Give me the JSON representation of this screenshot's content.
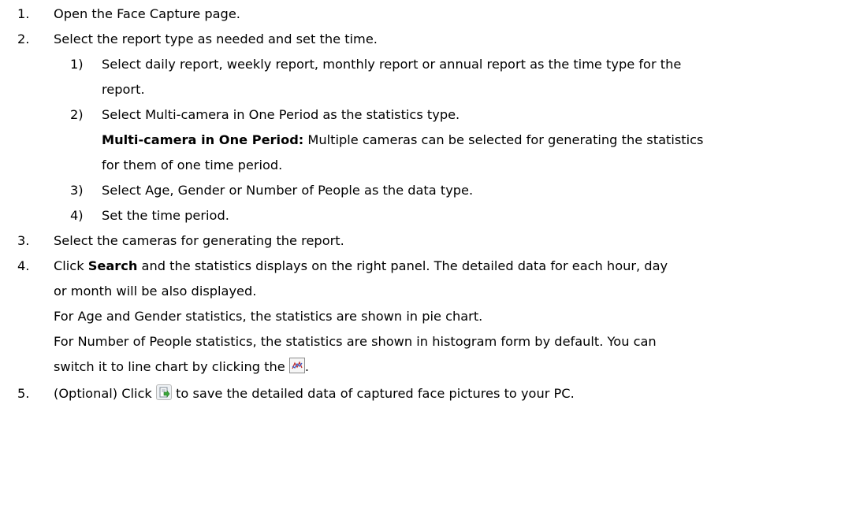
{
  "steps": [
    {
      "num": "1.",
      "text": "Open the Face Capture page."
    },
    {
      "num": "2.",
      "text": "Select the report type as needed and set the time."
    },
    {
      "num": "3.",
      "text": "Select the cameras for generating the report."
    },
    {
      "num": "4.",
      "text_pre": "Click ",
      "bold": "Search",
      "text_post": " and the statistics displays on the right panel. The detailed data for each hour, day"
    },
    {
      "num": "5.",
      "text_pre": "(Optional) Click ",
      "text_post": " to save the detailed data of captured face pictures to your PC."
    }
  ],
  "substeps": [
    {
      "num": "1)",
      "line1": "Select daily report, weekly report, monthly report or annual report as the time type for the",
      "line2": "report."
    },
    {
      "num": "2)",
      "line1": "Select Multi-camera in One Period as the statistics type."
    },
    {
      "num": "3)",
      "text": "Select Age, Gender or Number of People as the data type."
    },
    {
      "num": "4)",
      "text": "Set the time period."
    }
  ],
  "note": {
    "bold": "Multi-camera in One Period:",
    "text": " Multiple cameras can be selected for generating the statistics",
    "line2": "for them of one time period."
  },
  "step4_cont": {
    "line2": "or month will be also displayed.",
    "line3": "For Age and Gender statistics, the statistics are shown in pie chart.",
    "line4": "For Number of People statistics, the statistics are shown in histogram form by default. You can",
    "line5_pre": "switch it to line chart by clicking the ",
    "line5_post": "."
  },
  "icons": {
    "line_chart": "line-chart-icon",
    "export": "export-icon"
  }
}
